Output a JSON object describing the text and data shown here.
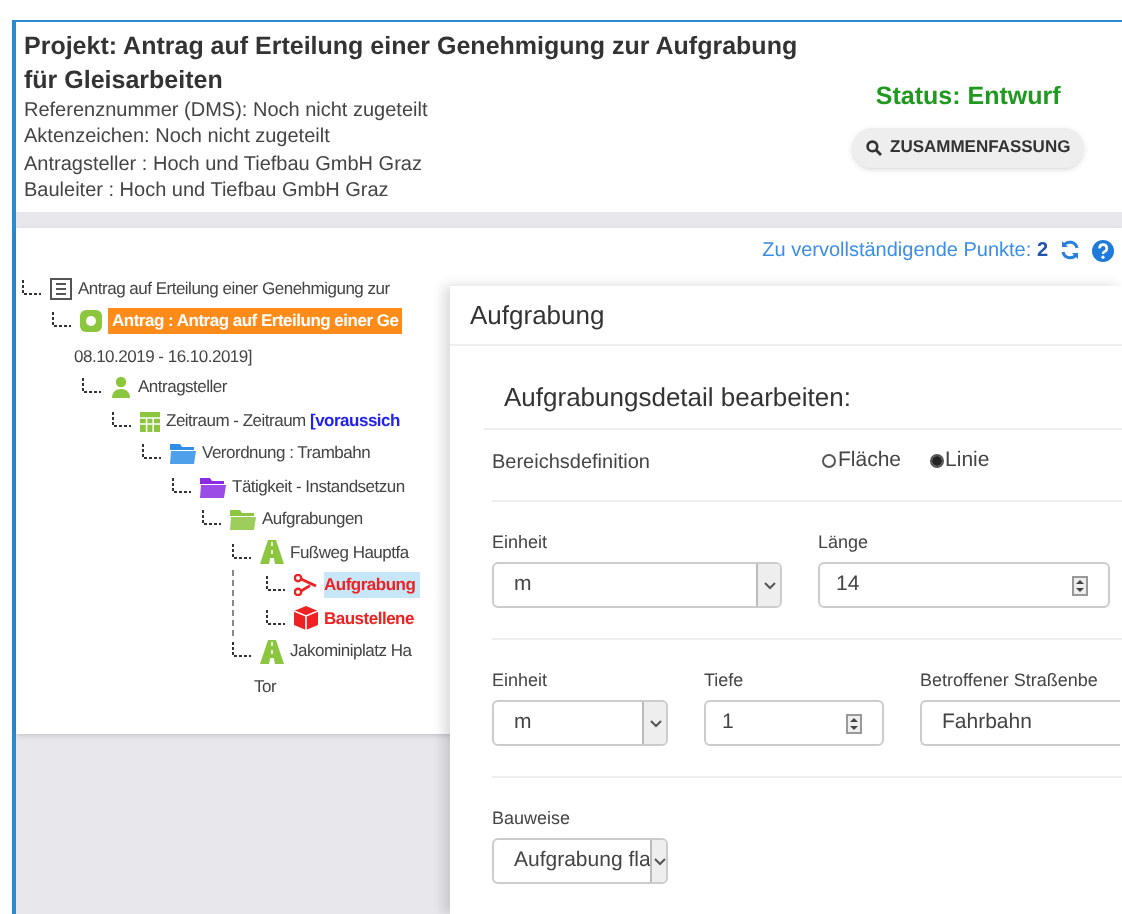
{
  "project": {
    "title": "Projekt: Antrag auf Erteilung einer Genehmigung zur Aufgrabung für Gleisarbeiten",
    "details": [
      "Referenznummer (DMS): Noch nicht zugeteilt",
      "Aktenzeichen: Noch nicht zugeteilt",
      "Antragsteller : Hoch und Tiefbau GmbH Graz",
      "Bauleiter : Hoch und Tiefbau GmbH Graz"
    ],
    "status": "Status: Entwurf",
    "summary_button": "ZUSAMMENFASSUNG"
  },
  "toolbar": {
    "pending_label": "Zu vervollständigende Punkte:",
    "pending_count": "2"
  },
  "tree": [
    {
      "label": "Antrag auf Erteilung einer Genehmigung zur",
      "kind": "list",
      "color": "#555555",
      "highlighted": false,
      "error": false,
      "selected": false,
      "children": [
        {
          "label": "Antrag : Antrag auf Erteilung einer Ge",
          "continuation": "08.10.2019 - 16.10.2019]",
          "kind": "ring",
          "color": "#8cc63f",
          "highlighted": true,
          "error": false,
          "selected": false,
          "children": [
            {
              "label": "Antragsteller",
              "kind": "person",
              "color": "#8cc63f",
              "highlighted": false,
              "error": false,
              "selected": false,
              "children": [
                {
                  "label": "Zeitraum - Zeitraum",
                  "note": "[voraussich",
                  "kind": "calendar",
                  "color": "#8cc63f",
                  "highlighted": false,
                  "error": false,
                  "selected": false,
                  "children": [
                    {
                      "label": "Verordnung : Trambahn",
                      "kind": "folder",
                      "color": "#2f8fe8",
                      "highlighted": false,
                      "error": false,
                      "selected": false,
                      "children": [
                        {
                          "label": "Tätigkeit - Instandsetzun",
                          "kind": "folder",
                          "color": "#8a2be2",
                          "highlighted": false,
                          "error": false,
                          "selected": false,
                          "children": [
                            {
                              "label": "Aufgrabungen",
                              "kind": "folder",
                              "color": "#8cc63f",
                              "highlighted": false,
                              "error": false,
                              "selected": false,
                              "children": [
                                {
                                  "label": "Fußweg Hauptfa",
                                  "kind": "road",
                                  "color": "#8cc63f",
                                  "highlighted": false,
                                  "error": false,
                                  "selected": false,
                                  "children": [
                                    {
                                      "label": "Aufgrabung",
                                      "kind": "branch",
                                      "color": "#ee2222",
                                      "highlighted": false,
                                      "error": true,
                                      "selected": true
                                    },
                                    {
                                      "label": "Baustellene",
                                      "kind": "cube",
                                      "color": "#ee2222",
                                      "highlighted": false,
                                      "error": true,
                                      "selected": false
                                    }
                                  ]
                                },
                                {
                                  "label": "Jakominiplatz Ha",
                                  "continuation": "Tor",
                                  "kind": "road",
                                  "color": "#8cc63f",
                                  "highlighted": false,
                                  "error": false,
                                  "selected": false
                                }
                              ]
                            }
                          ]
                        }
                      ]
                    }
                  ]
                }
              ]
            }
          ]
        }
      ]
    }
  ],
  "dialog": {
    "title": "Aufgrabung",
    "heading": "Aufgrabungsdetail bearbeiten:",
    "area": {
      "label": "Bereichsdefinition",
      "options": [
        {
          "label": "Fläche",
          "selected": false
        },
        {
          "label": "Linie",
          "selected": true
        }
      ]
    },
    "rows": [
      [
        {
          "label": "Einheit",
          "kind": "select",
          "value": "m"
        },
        {
          "label": "Länge",
          "kind": "number",
          "value": "14"
        }
      ],
      [
        {
          "label": "Einheit",
          "kind": "select",
          "value": "m"
        },
        {
          "label": "Tiefe",
          "kind": "number",
          "value": "1"
        },
        {
          "label": "Betroffener Straßenbe",
          "kind": "text",
          "value": "Fahrbahn"
        }
      ],
      [
        {
          "label": "Bauweise",
          "kind": "select",
          "value": "Aufgrabung fla"
        }
      ]
    ]
  }
}
